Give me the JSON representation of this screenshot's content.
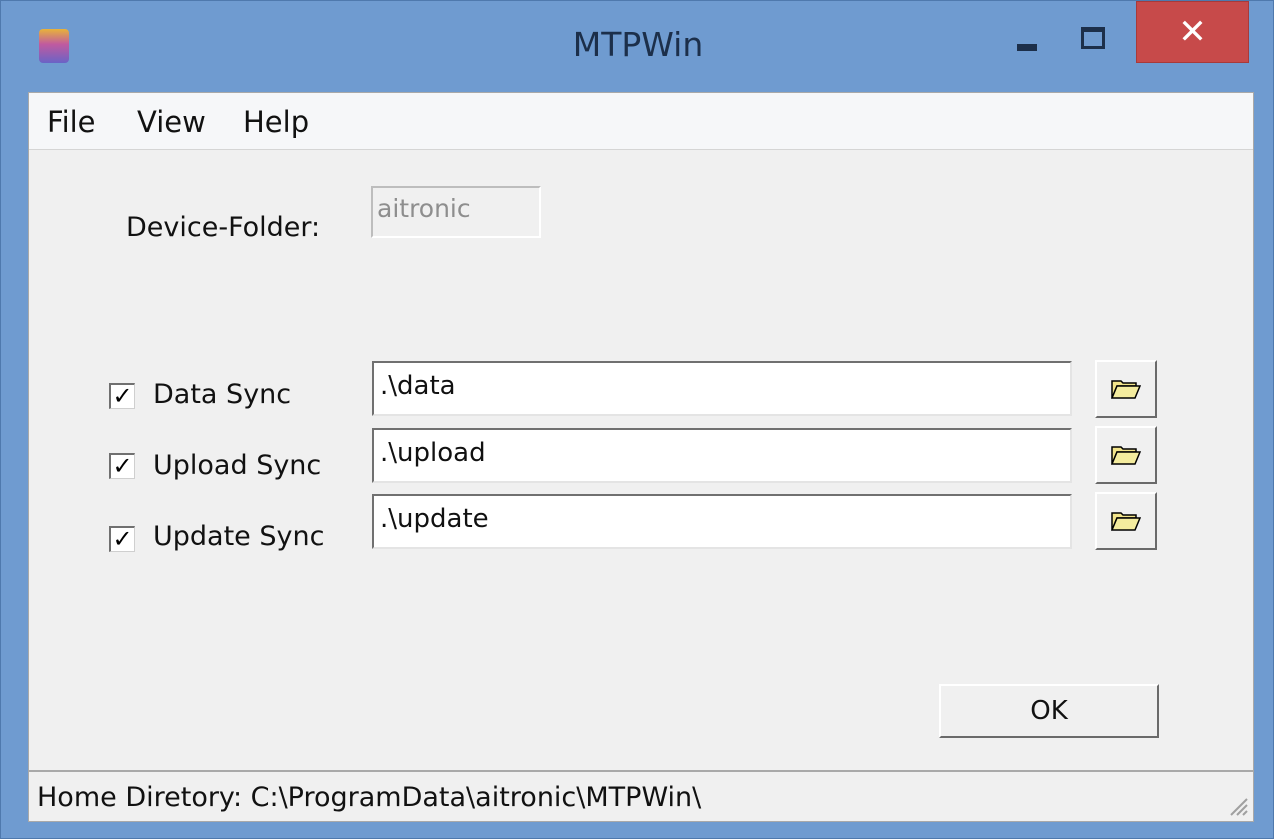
{
  "window": {
    "title": "MTPWin",
    "close_glyph": "✕"
  },
  "menu": {
    "file": "File",
    "view": "View",
    "help": "Help"
  },
  "device": {
    "label": "Device-Folder:",
    "value": "aitronic"
  },
  "sync": [
    {
      "label": "Data Sync",
      "checked": true,
      "path": ".\\data"
    },
    {
      "label": "Upload Sync",
      "checked": true,
      "path": ".\\upload"
    },
    {
      "label": "Update Sync",
      "checked": true,
      "path": ".\\update"
    }
  ],
  "check_glyph": "✓",
  "buttons": {
    "ok": "OK"
  },
  "status": {
    "text": "Home Diretory: C:\\ProgramData\\aitronic\\MTPWin\\"
  },
  "colors": {
    "titlebar": "#6f9bd0",
    "close": "#c74a4a",
    "client": "#f0f0f0"
  }
}
